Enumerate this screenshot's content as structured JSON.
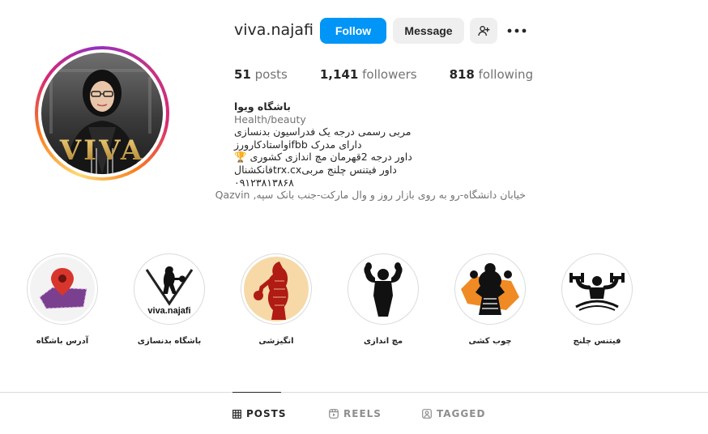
{
  "profile": {
    "username": "viva.najafi",
    "avatar_text": "VIVA",
    "follow_label": "Follow",
    "message_label": "Message",
    "add_user_icon": "add-user-icon",
    "more_icon": "more-icon"
  },
  "stats": {
    "posts_count": "51",
    "posts_label": "posts",
    "followers_count": "1,141",
    "followers_label": "followers",
    "following_count": "818",
    "following_label": "following"
  },
  "bio": {
    "name": "باشگاه ویوا",
    "category": "Health/beauty",
    "lines": [
      "مربی رسمی درجه یک فدراسیون بدنسازی",
      "دارای مدرک ifbbواستادکارورز",
      "داور درجه 2قهرمان مچ اندازی کشوری 🏆",
      "داور فیتنس چلنج مربیtrx.cxفانکشنال",
      "۰۹۱۲۳۸۱۳۸۶۸"
    ],
    "location": "خیابان دانشگاه-رو به روی بازار روز و وال مارکت-جنب بانک سپه, Qazvin"
  },
  "highlights": [
    {
      "label": "آدرس باشگاه",
      "icon": "location-pin-icon"
    },
    {
      "label": "باشگاه بدنسازی",
      "icon": "gym-logo-icon",
      "logo_text": "viva.najafi"
    },
    {
      "label": "انگیزشی",
      "icon": "motivation-icon"
    },
    {
      "label": "مچ اندازی",
      "icon": "arm-wrestling-icon"
    },
    {
      "label": "چوب کشی",
      "icon": "stick-pulling-icon"
    },
    {
      "label": "فیتنس چلنج",
      "icon": "fitness-challenge-icon"
    }
  ],
  "tabs": [
    {
      "label": "POSTS",
      "icon": "grid-icon",
      "active": true
    },
    {
      "label": "REELS",
      "icon": "reels-icon",
      "active": false
    },
    {
      "label": "TAGGED",
      "icon": "tagged-icon",
      "active": false
    }
  ],
  "colors": {
    "follow_blue": "#0095f6",
    "button_gray": "#efefef",
    "text_primary": "#262626",
    "text_secondary": "#737373"
  }
}
